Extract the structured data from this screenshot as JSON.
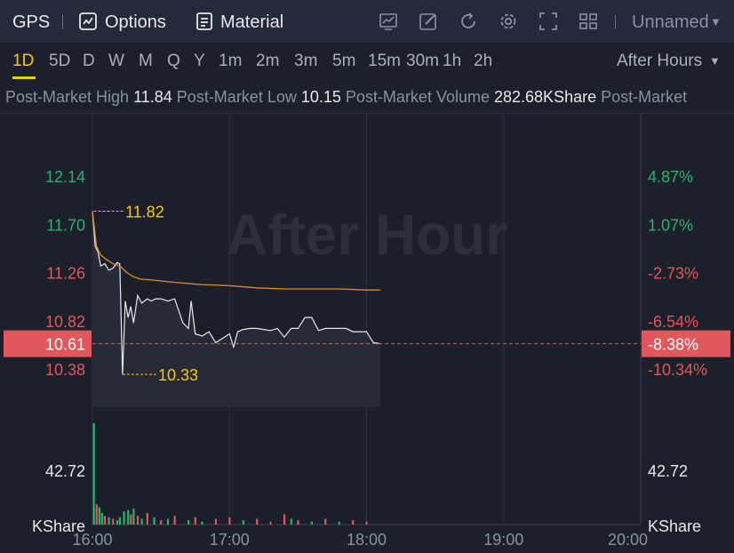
{
  "header": {
    "symbol": "GPS",
    "options_label": "Options",
    "material_label": "Material",
    "layout_name": "Unnamed"
  },
  "timeframes": {
    "items": [
      "1D",
      "5D",
      "D",
      "W",
      "M",
      "Q",
      "Y",
      "1m",
      "2m",
      "3m",
      "5m",
      "15m",
      "30m",
      "1h",
      "2h"
    ],
    "active": "1D",
    "session": "After Hours"
  },
  "info_bar": {
    "high_label": "Post-Market High",
    "high_value": "11.84",
    "low_label": "Post-Market Low",
    "low_value": "10.15",
    "volume_label": "Post-Market Volume",
    "volume_value": "282.68KShare",
    "more_label": "Post-Market"
  },
  "chart_data": {
    "type": "line",
    "watermark": "After Hour",
    "x_ticks": [
      "16:00",
      "17:00",
      "18:00",
      "19:00",
      "20:00"
    ],
    "x_range_hours": [
      16,
      20
    ],
    "price_ticks": [
      {
        "price": "12.14",
        "pct": "4.87%",
        "color": "#26b36b"
      },
      {
        "price": "11.70",
        "pct": "1.07%",
        "color": "#26b36b"
      },
      {
        "price": "11.26",
        "pct": "-2.73%",
        "color": "#e0575c"
      },
      {
        "price": "10.82",
        "pct": "-6.54%",
        "color": "#e0575c"
      },
      {
        "price": "10.38",
        "pct": "-10.34%",
        "color": "#e0575c"
      }
    ],
    "ylim": [
      10.1,
      12.4
    ],
    "current": {
      "price": "10.61",
      "pct": "-8.38%"
    },
    "high_marker": "11.82",
    "low_marker": "10.33",
    "volume_tick": "42.72",
    "volume_unit": "KShare",
    "series": [
      {
        "x": [
          16.0,
          16.02,
          16.04,
          16.06,
          16.09,
          16.12,
          16.15,
          16.18,
          16.2,
          16.22,
          16.24,
          16.26,
          16.28,
          16.3,
          16.33,
          16.36,
          16.4,
          16.43,
          16.46,
          16.5,
          16.55,
          16.6,
          16.66,
          16.7,
          16.72,
          16.75,
          16.8,
          16.85,
          16.9,
          16.95,
          17.0,
          17.03,
          17.06,
          17.1,
          17.15,
          17.2,
          17.25,
          17.3,
          17.35,
          17.4,
          17.45,
          17.5,
          17.55,
          17.6,
          17.65,
          17.7,
          17.75,
          17.8,
          17.85,
          17.9,
          17.95,
          18.0,
          18.05,
          18.1
        ],
        "values": [
          11.82,
          11.5,
          11.45,
          11.32,
          11.34,
          11.28,
          11.3,
          11.35,
          11.34,
          10.33,
          11.0,
          10.85,
          10.95,
          10.8,
          11.05,
          10.98,
          11.02,
          11.0,
          11.02,
          11.02,
          11.0,
          11.02,
          10.8,
          10.75,
          11.0,
          10.7,
          10.68,
          10.72,
          10.62,
          10.66,
          10.7,
          10.58,
          10.72,
          10.74,
          10.75,
          10.75,
          10.74,
          10.73,
          10.75,
          10.67,
          10.75,
          10.75,
          10.85,
          10.85,
          10.73,
          10.75,
          10.75,
          10.75,
          10.75,
          10.72,
          10.72,
          10.72,
          10.62,
          10.61
        ]
      },
      {
        "x": [
          16.0,
          16.03,
          16.06,
          16.1,
          16.15,
          16.2,
          16.25,
          16.3,
          16.35,
          16.45,
          16.6,
          16.8,
          17.0,
          17.2,
          17.4,
          17.6,
          17.8,
          18.0,
          18.1
        ],
        "values": [
          11.82,
          11.5,
          11.42,
          11.38,
          11.34,
          11.32,
          11.26,
          11.22,
          11.2,
          11.19,
          11.17,
          11.15,
          11.14,
          11.12,
          11.11,
          11.11,
          11.11,
          11.1,
          11.1
        ],
        "color": "#e08a2c"
      }
    ],
    "volume": {
      "x": [
        16.01,
        16.03,
        16.05,
        16.07,
        16.09,
        16.12,
        16.15,
        16.18,
        16.2,
        16.23,
        16.26,
        16.28,
        16.3,
        16.33,
        16.36,
        16.4,
        16.45,
        16.5,
        16.55,
        16.6,
        16.7,
        16.75,
        16.8,
        16.9,
        17.0,
        17.1,
        17.2,
        17.3,
        17.4,
        17.45,
        17.5,
        17.6,
        17.7,
        17.8,
        17.9,
        18.0
      ],
      "values": [
        70,
        14,
        12,
        8,
        6,
        5,
        4,
        3,
        5,
        9,
        10,
        7,
        11,
        6,
        4,
        8,
        5,
        3,
        4,
        6,
        3,
        5,
        2,
        4,
        5,
        3,
        4,
        2,
        7,
        4,
        3,
        2,
        4,
        2,
        3,
        2
      ],
      "up": [
        true,
        false,
        true,
        true,
        false,
        true,
        false,
        true,
        true,
        true,
        true,
        false,
        true,
        false,
        true,
        false,
        true,
        false,
        true,
        false,
        true,
        false,
        true,
        false,
        false,
        true,
        false,
        false,
        false,
        true,
        false,
        true,
        false,
        true,
        false,
        false
      ]
    }
  }
}
